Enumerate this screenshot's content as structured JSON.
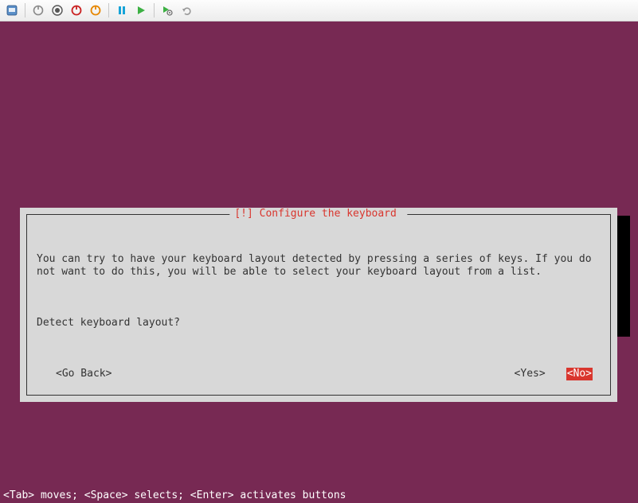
{
  "toolbar": {
    "icons": [
      "app",
      "power-gray",
      "record",
      "power-red",
      "power-orange",
      "pause",
      "play",
      "play-gear",
      "undo"
    ]
  },
  "dialog": {
    "title_marker": "[!]",
    "title": "Configure the keyboard",
    "body_line1": "You can try to have your keyboard layout detected by pressing a series of keys. If you do not want to do this, you will be able to select your keyboard layout from a list.",
    "body_line2": "Detect keyboard layout?",
    "buttons": {
      "go_back": "<Go Back>",
      "yes": "<Yes>",
      "no": "<No>"
    },
    "selected": "no"
  },
  "hint": "<Tab> moves; <Space> selects; <Enter> activates buttons"
}
